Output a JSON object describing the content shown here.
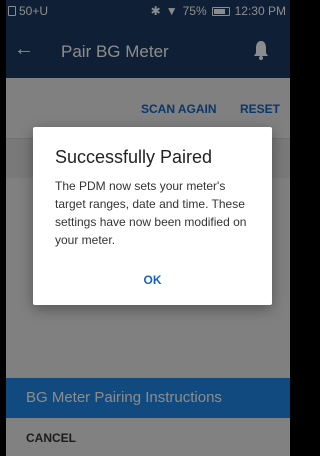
{
  "status": {
    "left_text": "50+U",
    "battery": "75%",
    "time": "12:30 PM",
    "icons": [
      "pdm-icon",
      "bluetooth-icon",
      "wifi-icon",
      "battery-icon"
    ]
  },
  "appbar": {
    "title": "Pair BG Meter",
    "icons": [
      "back-arrow-icon",
      "bell-icon"
    ]
  },
  "actions": {
    "scan_again": "SCAN AGAIN",
    "reset": "RESET"
  },
  "instructions": {
    "label": "BG Meter Pairing Instructions"
  },
  "footer": {
    "cancel": "CANCEL"
  },
  "dialog": {
    "title": "Successfully Paired",
    "body": "The PDM now sets your meter's target ranges, date and time. These settings have now been modified on your meter.",
    "ok": "OK"
  },
  "colors": {
    "appbar": "#1b3a63",
    "accent": "#1565c0",
    "instructions_bar": "#1e88e5"
  }
}
